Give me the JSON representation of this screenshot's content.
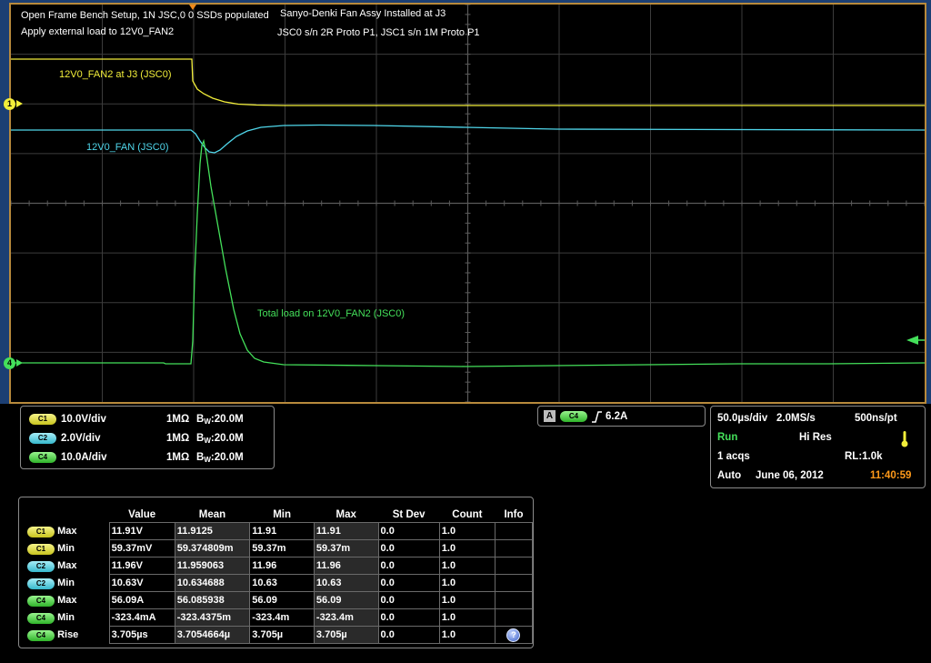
{
  "annotations": {
    "line1": "Open Frame Bench Setup, 1N JSC,0 0 SSDs populated",
    "line2": "Apply external load to 12V0_FAN2",
    "line3": "Sanyo-Denki Fan Assy Installed at J3",
    "line4": "JSC0 s/n 2R Proto P1, JSC1 s/n 1M Proto P1",
    "trace_yellow": "12V0_FAN2 at J3 (JSC0)",
    "trace_cyan": "12V0_FAN (JSC0)",
    "trace_green": "Total load on 12V0_FAN2 (JSC0)"
  },
  "markers": {
    "ch1": "1",
    "ch4": "4"
  },
  "colors": {
    "ch1": "#f2ee3a",
    "ch2": "#4fd6ea",
    "ch4": "#44e05a",
    "frame": "#b88a3c",
    "time_accent": "#ff9a1a"
  },
  "channels": [
    {
      "badge": "C1",
      "scale": "10.0V/div",
      "imp": "1MΩ",
      "bw": "W:20.0M"
    },
    {
      "badge": "C2",
      "scale": "2.0V/div",
      "imp": "1MΩ",
      "bw": "W:20.0M"
    },
    {
      "badge": "C4",
      "scale": "10.0A/div",
      "imp": "1MΩ",
      "bw": "W:20.0M"
    }
  ],
  "trigger": {
    "mode": "A",
    "source": "C4",
    "level": "6.2A"
  },
  "acquisition": {
    "timebase": "50.0µs/div",
    "sample_rate": "2.0MS/s",
    "resolution": "500ns/pt",
    "state": "Run",
    "mode": "Hi Res",
    "acqs": "1 acqs",
    "record_length": "RL:1.0k",
    "trigger_mode": "Auto",
    "date": "June 06, 2012",
    "time": "11:40:59"
  },
  "measurements": {
    "headers": [
      "Value",
      "Mean",
      "Min",
      "Max",
      "St Dev",
      "Count",
      "Info"
    ],
    "rows": [
      {
        "ch": "C1",
        "type": "Max",
        "value": "11.91V",
        "mean": "11.9125",
        "min": "11.91",
        "max": "11.91",
        "stdev": "0.0",
        "count": "1.0"
      },
      {
        "ch": "C1",
        "type": "Min",
        "value": "59.37mV",
        "mean": "59.374809m",
        "min": "59.37m",
        "max": "59.37m",
        "stdev": "0.0",
        "count": "1.0"
      },
      {
        "ch": "C2",
        "type": "Max",
        "value": "11.96V",
        "mean": "11.959063",
        "min": "11.96",
        "max": "11.96",
        "stdev": "0.0",
        "count": "1.0"
      },
      {
        "ch": "C2",
        "type": "Min",
        "value": "10.63V",
        "mean": "10.634688",
        "min": "10.63",
        "max": "10.63",
        "stdev": "0.0",
        "count": "1.0"
      },
      {
        "ch": "C4",
        "type": "Max",
        "value": "56.09A",
        "mean": "56.085938",
        "min": "56.09",
        "max": "56.09",
        "stdev": "0.0",
        "count": "1.0"
      },
      {
        "ch": "C4",
        "type": "Min",
        "value": "-323.4mA",
        "mean": "-323.4375m",
        "min": "-323.4m",
        "max": "-323.4m",
        "stdev": "0.0",
        "count": "1.0"
      },
      {
        "ch": "C4",
        "type": "Rise",
        "value": "3.705µs",
        "mean": "3.7054664µ",
        "min": "3.705µ",
        "max": "3.705µ",
        "stdev": "0.0",
        "count": "1.0"
      }
    ]
  }
}
